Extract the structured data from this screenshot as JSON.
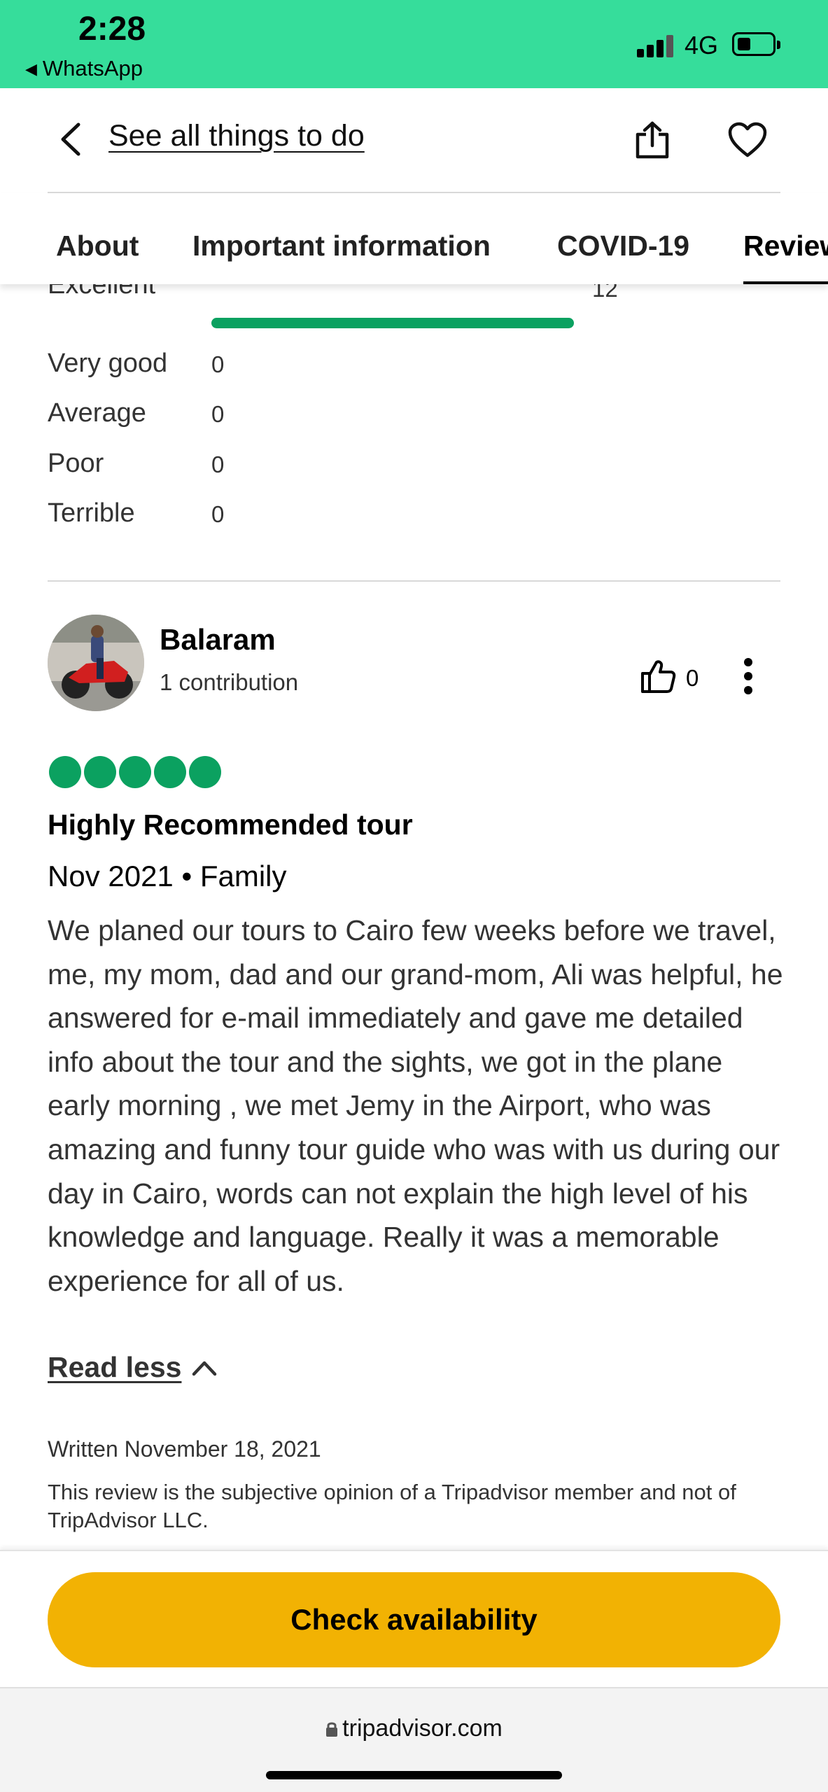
{
  "status_bar": {
    "time": "2:28",
    "back_app": "WhatsApp",
    "network": "4G"
  },
  "header": {
    "back_link": "See all things to do",
    "icons": [
      "chevron-left-icon",
      "share-icon",
      "heart-icon"
    ]
  },
  "tabs": [
    {
      "label": "About"
    },
    {
      "label": "Important information"
    },
    {
      "label": "COVID-19"
    },
    {
      "label": "Reviews",
      "active": true
    }
  ],
  "ratings": {
    "rows": [
      {
        "label": "Excellent",
        "count": "12",
        "fraction": 1.0
      },
      {
        "label": "Very good",
        "count": "0"
      },
      {
        "label": "Average",
        "count": "0"
      },
      {
        "label": "Poor",
        "count": "0"
      },
      {
        "label": "Terrible",
        "count": "0"
      }
    ],
    "bar_color": "#0ba160"
  },
  "review": {
    "reviewer_name": "Balaram",
    "contributions": "1 contribution",
    "helpful_votes": "0",
    "rating_bubbles": 5,
    "title": "Highly Recommended tour",
    "meta": "Nov 2021 • Family",
    "body": "We planed our tours to Cairo few weeks before we travel, me, my mom, dad and our grand-mom, Ali was helpful, he answered for e-mail immediately and gave me detailed info about the tour and the sights, we got in the plane early morning , we met Jemy in the Airport, who was amazing and funny tour guide who was with us during our day in Cairo, words can not explain the high level of his knowledge and language. Really it was a memorable experience for all of us.",
    "read_less": "Read less",
    "written": "Written November 18, 2021",
    "disclaimer": "This review is the subjective opinion of a Tripadvisor member and not of TripAdvisor LLC."
  },
  "cta": {
    "label": "Check availability",
    "color": "#f2b203"
  },
  "browser": {
    "url": "tripadvisor.com"
  },
  "colors": {
    "status_bar_bg": "#36dd9b",
    "accent_green": "#0ba160"
  }
}
